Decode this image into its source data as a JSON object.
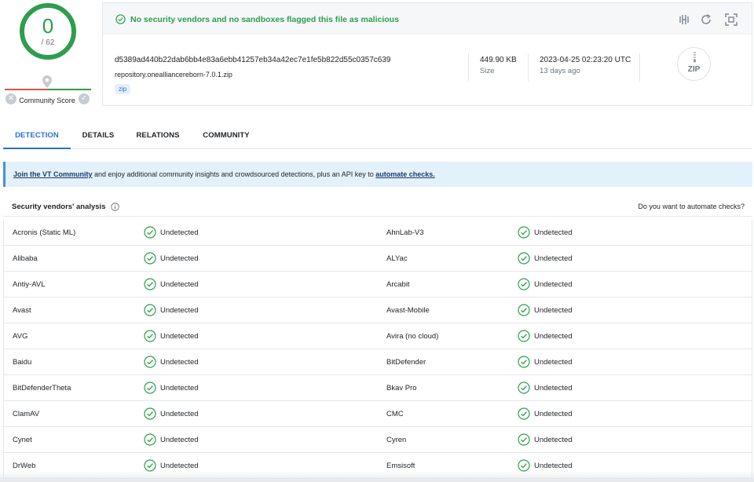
{
  "score": {
    "detections": "0",
    "total": "/ 62",
    "community_label": "Community Score",
    "color": "#2e9d4e"
  },
  "banner": {
    "text": "No security vendors and no sandboxes flagged this file as malicious",
    "icon": "check-circle-icon"
  },
  "toolbar": {
    "icons": [
      "compare-icon",
      "reanalyze-icon",
      "similar-icon"
    ]
  },
  "file": {
    "hash": "d5389ad440b22dab6bb4e83a6ebb41257eb34a42ec7e1fe5b822d55c0357c639",
    "name": "repository.onealliancereborn-7.0.1.zip",
    "tag": "zip",
    "size": "449.90 KB",
    "size_label": "Size",
    "date": "2023-04-25 02:23:20 UTC",
    "date_ago": "13 days ago",
    "type_badge": "ZIP"
  },
  "tabs": [
    "DETECTION",
    "DETAILS",
    "RELATIONS",
    "COMMUNITY"
  ],
  "active_tab": "DETECTION",
  "notice": {
    "link1": "Join the VT Community",
    "middle": " and enjoy additional community insights and crowdsourced detections, plus an API key to ",
    "link2": "automate checks."
  },
  "vendors": {
    "title": "Security vendors' analysis",
    "automate_question": "Do you want to automate checks?",
    "status_text": "Undetected",
    "rows": [
      [
        "Acronis (Static ML)",
        "AhnLab-V3"
      ],
      [
        "Alibaba",
        "ALYac"
      ],
      [
        "Antiy-AVL",
        "Arcabit"
      ],
      [
        "Avast",
        "Avast-Mobile"
      ],
      [
        "AVG",
        "Avira (no cloud)"
      ],
      [
        "Baidu",
        "BitDefender"
      ],
      [
        "BitDefenderTheta",
        "Bkav Pro"
      ],
      [
        "ClamAV",
        "CMC"
      ],
      [
        "Cynet",
        "Cyren"
      ],
      [
        "DrWeb",
        "Emsisoft"
      ]
    ]
  }
}
